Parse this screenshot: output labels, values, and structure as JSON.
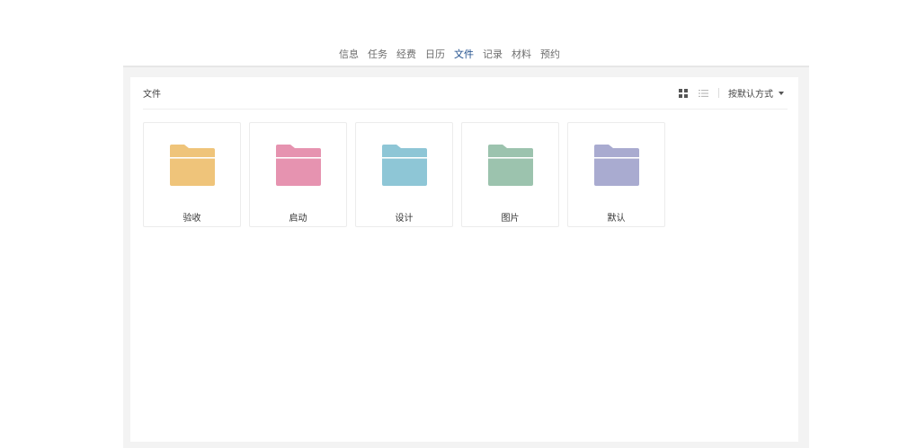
{
  "nav": {
    "items": [
      "信息",
      "任务",
      "经费",
      "日历",
      "文件",
      "记录",
      "材料",
      "预约"
    ],
    "active_index": 4,
    "active_color": "#1f4e8c"
  },
  "panel": {
    "title": "文件",
    "toolbar": {
      "grid_view_icon": "grid-icon",
      "list_view_icon": "list-icon",
      "sort_label": "按默认方式"
    }
  },
  "folders": [
    {
      "name": "验收",
      "color": "#efc47a",
      "icon": "folder-icon"
    },
    {
      "name": "启动",
      "color": "#e693b0",
      "icon": "folder-icon"
    },
    {
      "name": "设计",
      "color": "#8ec6d6",
      "icon": "folder-icon"
    },
    {
      "name": "图片",
      "color": "#9cc3ae",
      "icon": "folder-icon"
    },
    {
      "name": "默认",
      "color": "#a9abd0",
      "icon": "folder-icon"
    }
  ]
}
